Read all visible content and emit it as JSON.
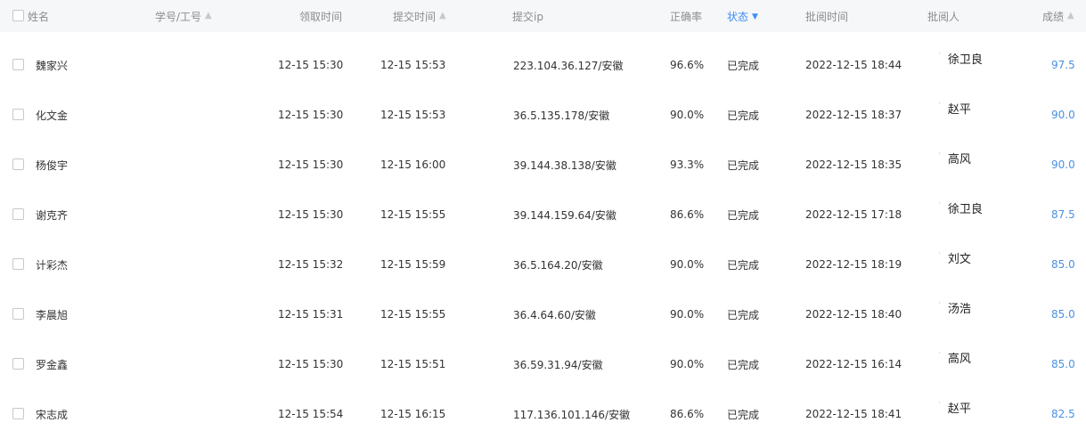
{
  "header": {
    "name": "姓名",
    "student_id": "学号/工号",
    "receive_time": "领取时间",
    "submit_time": "提交时间",
    "submit_ip": "提交ip",
    "accuracy": "正确率",
    "status": "状态",
    "review_time": "批阅时间",
    "reviewer": "批阅人",
    "score": "成绩"
  },
  "rows": [
    {
      "name": "魏家兴",
      "receive_time": "12-15 15:30",
      "submit_time": "12-15 15:53",
      "ip": "223.104.36.127/安徽",
      "accuracy": "96.6%",
      "status": "已完成",
      "review_time": "2022-12-15 18:44",
      "reviewer": "徐卫良",
      "score": "97.5"
    },
    {
      "name": "化文金",
      "receive_time": "12-15 15:30",
      "submit_time": "12-15 15:53",
      "ip": "36.5.135.178/安徽",
      "accuracy": "90.0%",
      "status": "已完成",
      "review_time": "2022-12-15 18:37",
      "reviewer": "赵平",
      "score": "90.0"
    },
    {
      "name": "杨俊宇",
      "receive_time": "12-15 15:30",
      "submit_time": "12-15 16:00",
      "ip": "39.144.38.138/安徽",
      "accuracy": "93.3%",
      "status": "已完成",
      "review_time": "2022-12-15 18:35",
      "reviewer": "高风",
      "score": "90.0"
    },
    {
      "name": "谢克齐",
      "receive_time": "12-15 15:30",
      "submit_time": "12-15 15:55",
      "ip": "39.144.159.64/安徽",
      "accuracy": "86.6%",
      "status": "已完成",
      "review_time": "2022-12-15 17:18",
      "reviewer": "徐卫良",
      "score": "87.5"
    },
    {
      "name": "计彩杰",
      "receive_time": "12-15 15:32",
      "submit_time": "12-15 15:59",
      "ip": "36.5.164.20/安徽",
      "accuracy": "90.0%",
      "status": "已完成",
      "review_time": "2022-12-15 18:19",
      "reviewer": "刘文",
      "score": "85.0"
    },
    {
      "name": "李晨旭",
      "receive_time": "12-15 15:31",
      "submit_time": "12-15 15:55",
      "ip": "36.4.64.60/安徽",
      "accuracy": "90.0%",
      "status": "已完成",
      "review_time": "2022-12-15 18:40",
      "reviewer": "汤浩",
      "score": "85.0"
    },
    {
      "name": "罗金鑫",
      "receive_time": "12-15 15:30",
      "submit_time": "12-15 15:51",
      "ip": "36.59.31.94/安徽",
      "accuracy": "90.0%",
      "status": "已完成",
      "review_time": "2022-12-15 16:14",
      "reviewer": "高风",
      "score": "85.0"
    },
    {
      "name": "宋志成",
      "receive_time": "12-15 15:54",
      "submit_time": "12-15 16:15",
      "ip": "117.136.101.146/安徽",
      "accuracy": "86.6%",
      "status": "已完成",
      "review_time": "2022-12-15 18:41",
      "reviewer": "赵平",
      "score": "82.5"
    }
  ],
  "icons": {
    "sort": "sort-up-arrow",
    "status_filter": "chevron-down"
  },
  "colors": {
    "header_bg": "#f6f7f9",
    "accent_blue": "#3e8ef7",
    "score_blue": "#4a90e2"
  }
}
